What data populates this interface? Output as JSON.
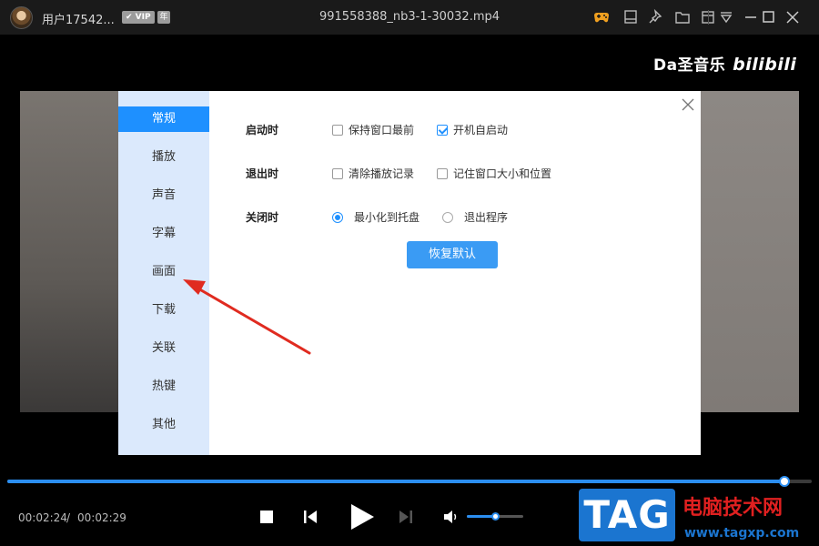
{
  "titlebar": {
    "username": "用户17542...",
    "vip_badge": "✔ VIP",
    "year_badge": "年",
    "filename": "991558388_nb3-1-30032.mp4",
    "icons": [
      "gamepad-icon",
      "screen-icon",
      "pin-icon",
      "folder-icon",
      "menu-icon",
      "minimize-icon",
      "maximize-icon",
      "close-icon"
    ]
  },
  "video": {
    "watermark_text": "Da圣音乐",
    "watermark_brand": "bilibili"
  },
  "dialog": {
    "nav": [
      "常规",
      "播放",
      "声音",
      "字幕",
      "画面",
      "下载",
      "关联",
      "热键",
      "其他"
    ],
    "active_nav": "常规",
    "rows": [
      {
        "label": "启动时",
        "options": [
          {
            "type": "checkbox",
            "label": "保持窗口最前",
            "checked": false
          },
          {
            "type": "checkbox",
            "label": "开机自启动",
            "checked": true
          }
        ]
      },
      {
        "label": "退出时",
        "options": [
          {
            "type": "checkbox",
            "label": "清除播放记录",
            "checked": false
          },
          {
            "type": "checkbox",
            "label": "记住窗口大小和位置",
            "checked": false
          }
        ]
      },
      {
        "label": "关闭时",
        "options": [
          {
            "type": "radio",
            "label": "最小化到托盘",
            "checked": true
          },
          {
            "type": "radio",
            "label": "退出程序",
            "checked": false
          }
        ]
      }
    ],
    "reset_label": "恢复默认"
  },
  "player": {
    "current_time": "00:02:24",
    "separator": "/",
    "total_time": "00:02:29",
    "progress_fraction": 0.966,
    "volume_fraction": 0.5,
    "accent_color": "#2b8ef0"
  },
  "site_watermark": {
    "logo": "TAG",
    "name": "电脑技术网",
    "url": "www.tagxp.com"
  }
}
